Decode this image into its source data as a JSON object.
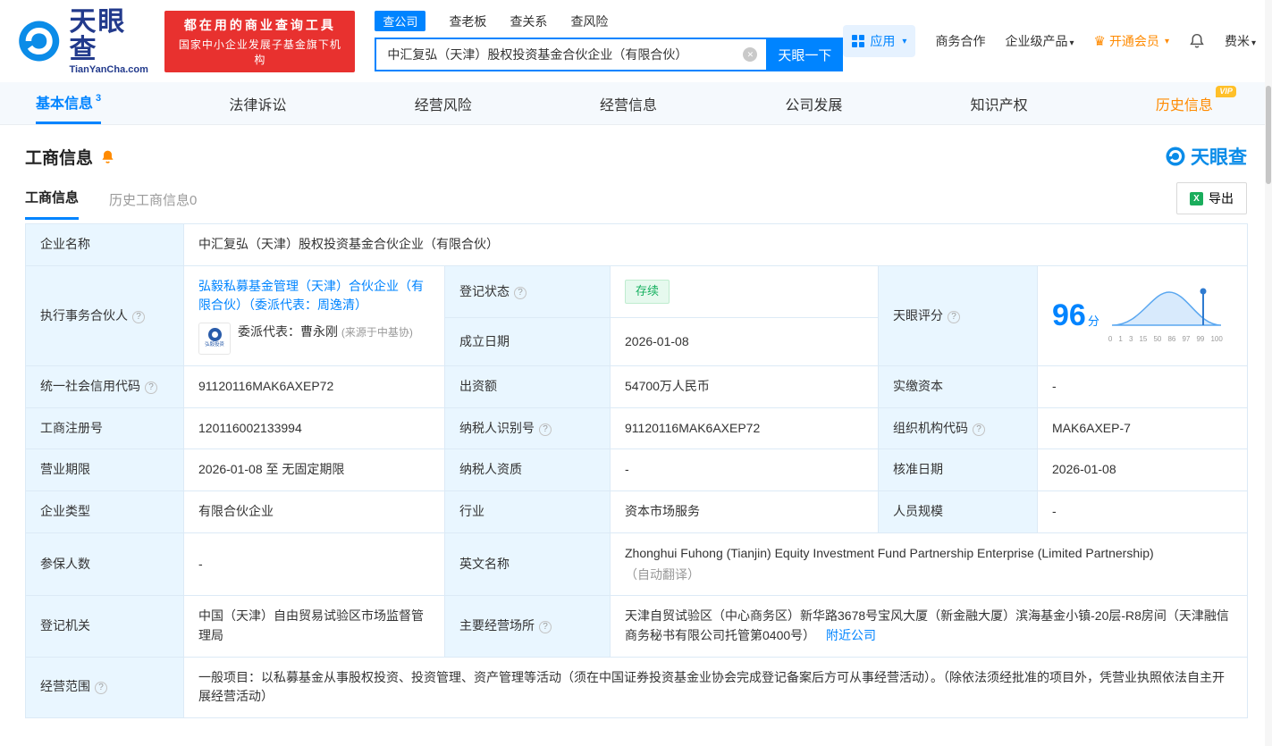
{
  "colors": {
    "primary": "#0084ff",
    "orange": "#ff8a00",
    "green": "#15b05f",
    "red": "#e8312f"
  },
  "icons": {
    "help": "?",
    "caret": "▾",
    "clear": "✕",
    "crown": "♛",
    "excel": "X"
  },
  "brand": {
    "name": "天眼查",
    "domain": "TianYanCha.com",
    "slogan_line1": "都在用的商业查询工具",
    "slogan_line2": "国家中小企业发展子基金旗下机构"
  },
  "search": {
    "tabs": [
      "查公司",
      "查老板",
      "查关系",
      "查风险"
    ],
    "value": "中汇复弘（天津）股权投资基金合伙企业（有限合伙）",
    "button": "天眼一下"
  },
  "menu": {
    "apps": "应用",
    "cooperation": "商务合作",
    "enterprise": "企业级产品",
    "vip": "开通会员",
    "user": "费米"
  },
  "nav": {
    "tabs": [
      {
        "label": "基本信息",
        "badge": "3"
      },
      {
        "label": "法律诉讼"
      },
      {
        "label": "经营风险"
      },
      {
        "label": "经营信息"
      },
      {
        "label": "公司发展"
      },
      {
        "label": "知识产权"
      },
      {
        "label": "历史信息",
        "tag": "VIP"
      }
    ]
  },
  "section": {
    "title": "工商信息",
    "tab_current": "工商信息",
    "tab_history": "历史工商信息0",
    "export": "导出",
    "watermark": "天眼查"
  },
  "info": {
    "company_name_label": "企业名称",
    "company_name": "中汇复弘（天津）股权投资基金合伙企业（有限合伙）",
    "partner_label": "执行事务合伙人",
    "partner_link": "弘毅私募基金管理（天津）合伙企业（有限合伙）（委派代表：周逸清）",
    "partner_logo_text": "弘毅投资",
    "partner_rep": "委派代表：曹永刚",
    "partner_rep_source": "(来源于中基协)",
    "status_label": "登记状态",
    "status": "存续",
    "established_label": "成立日期",
    "established": "2026-01-08",
    "score_label": "天眼评分",
    "score": {
      "value": "96",
      "unit": "分",
      "ticks": [
        "0",
        "1",
        "3",
        "15",
        "50",
        "86",
        "97",
        "99",
        "100"
      ]
    },
    "credit_code_label": "统一社会信用代码",
    "credit_code": "91120116MAK6AXEP72",
    "capital_label": "出资额",
    "capital": "54700万人民币",
    "paid_capital_label": "实缴资本",
    "paid_capital": "-",
    "reg_number_label": "工商注册号",
    "reg_number": "120116002133994",
    "taxpayer_id_label": "纳税人识别号",
    "taxpayer_id": "91120116MAK6AXEP72",
    "org_code_label": "组织机构代码",
    "org_code": "MAK6AXEP-7",
    "term_label": "营业期限",
    "term": "2026-01-08 至 无固定期限",
    "taxpayer_quality_label": "纳税人资质",
    "taxpayer_quality": "-",
    "approval_date_label": "核准日期",
    "approval_date": "2026-01-08",
    "company_type_label": "企业类型",
    "company_type": "有限合伙企业",
    "industry_label": "行业",
    "industry": "资本市场服务",
    "staff_size_label": "人员规模",
    "staff_size": "-",
    "insured_label": "参保人数",
    "insured": "-",
    "english_name_label": "英文名称",
    "english_name": "Zhonghui Fuhong (Tianjin) Equity Investment Fund Partnership Enterprise (Limited Partnership)",
    "english_name_note": "（自动翻译）",
    "registry_label": "登记机关",
    "registry": "中国（天津）自由贸易试验区市场监督管理局",
    "address_label": "主要经营场所",
    "address": "天津自贸试验区（中心商务区）新华路3678号宝风大厦（新金融大厦）滨海基金小镇-20层-R8房间（天津融信商务秘书有限公司托管第0400号）",
    "nearby_link": "附近公司",
    "scope_label": "经营范围",
    "scope": "一般项目：以私募基金从事股权投资、投资管理、资产管理等活动（须在中国证券投资基金业协会完成登记备案后方可从事经营活动）。（除依法须经批准的项目外，凭营业执照依法自主开展经营活动）"
  }
}
